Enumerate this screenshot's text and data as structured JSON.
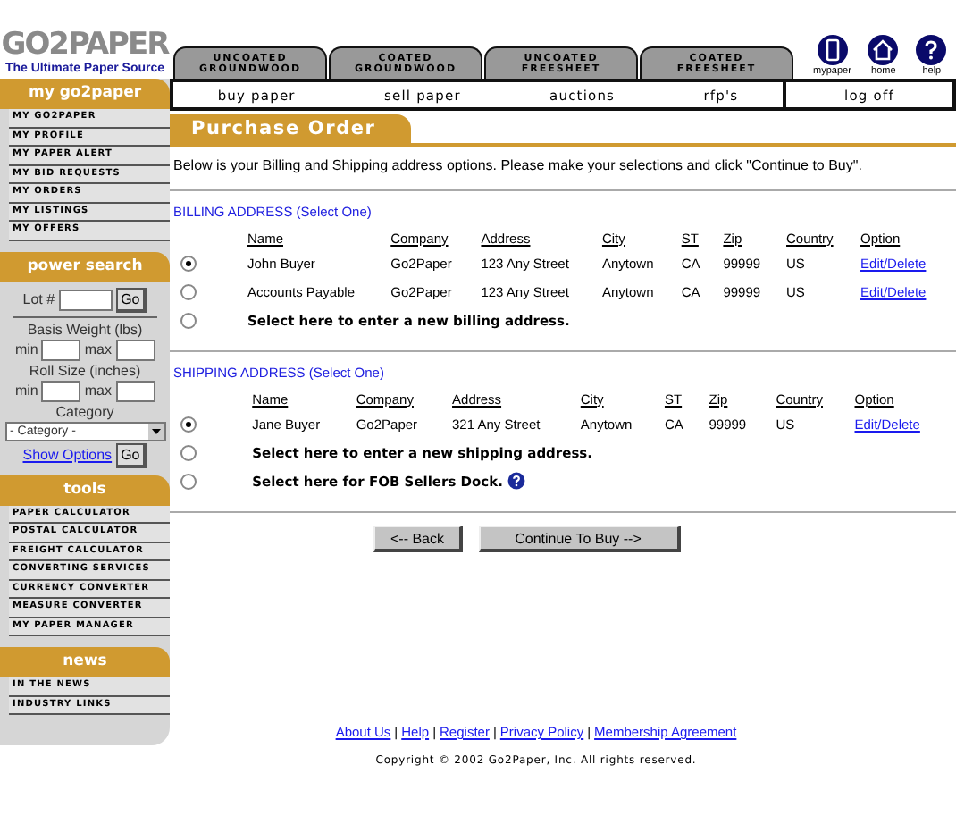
{
  "logo": {
    "text": "GO2PAPER",
    "tagline": "The Ultimate Paper Source"
  },
  "category_tabs": [
    {
      "label": "UNCOATED GROUNDWOOD"
    },
    {
      "label": "COATED GROUNDWOOD"
    },
    {
      "label": "UNCOATED FREESHEET"
    },
    {
      "label": "COATED FREESHEET"
    }
  ],
  "header_icons": [
    {
      "kind": "phone",
      "label": "mypaper"
    },
    {
      "kind": "home",
      "label": "home"
    },
    {
      "kind": "help",
      "label": "help"
    }
  ],
  "nav": {
    "items": [
      "buy paper",
      "sell paper",
      "auctions",
      "rfp's"
    ],
    "logoff": "log off"
  },
  "sidebar": [
    {
      "kind": "links",
      "title": "my go2paper",
      "items": [
        "MY GO2PAPER",
        "MY PROFILE",
        "MY PAPER ALERT",
        "MY BID REQUESTS",
        "MY ORDERS",
        "MY LISTINGS",
        "MY OFFERS"
      ]
    },
    {
      "kind": "search",
      "title": "power search",
      "lot_label": "Lot #",
      "go": "Go",
      "basis_label": "Basis Weight (lbs)",
      "roll_label": "Roll Size (inches)",
      "basis_min": "min",
      "basis_max": "max",
      "roll_min": "min",
      "roll_max": "max",
      "category_label": "Category",
      "category_value": "- Category -",
      "show_options": "Show Options",
      "go2": "Go"
    },
    {
      "kind": "links",
      "title": "tools",
      "items": [
        "PAPER CALCULATOR",
        "POSTAL CALCULATOR",
        "FREIGHT CALCULATOR",
        "CONVERTING SERVICES",
        "CURRENCY CONVERTER",
        "MEASURE CONVERTER",
        "MY PAPER MANAGER"
      ]
    },
    {
      "kind": "links",
      "title": "news",
      "items": [
        "IN THE NEWS",
        "INDUSTRY LINKS"
      ]
    }
  ],
  "page_title": "Purchase Order",
  "intro": "Below is your Billing and Shipping address options.  Please make your selections and click \"Continue to Buy\".",
  "sections": [
    {
      "title": "BILLING ADDRESS (Select One)",
      "columns": [
        "Name",
        "Company",
        "Address",
        "City",
        "ST",
        "Zip",
        "Country",
        "Option"
      ],
      "entries": [
        {
          "kind": "address",
          "selected": true,
          "cells": [
            "John Buyer",
            "Go2Paper",
            "123 Any Street",
            "Anytown",
            "CA",
            "99999",
            "US"
          ],
          "option": "Edit/Delete"
        },
        {
          "kind": "address",
          "selected": false,
          "cells": [
            "Accounts Payable",
            "Go2Paper",
            "123 Any Street",
            "Anytown",
            "CA",
            "99999",
            "US"
          ],
          "option": "Edit/Delete"
        },
        {
          "kind": "choice",
          "selected": false,
          "label": "Select here to enter a new billing address."
        }
      ]
    },
    {
      "title": "SHIPPING ADDRESS (Select One)",
      "columns": [
        "Name",
        "Company",
        "Address",
        "City",
        "ST",
        "Zip",
        "Country",
        "Option"
      ],
      "entries": [
        {
          "kind": "address",
          "selected": true,
          "cells": [
            "Jane Buyer",
            "Go2Paper",
            "321 Any Street",
            "Anytown",
            "CA",
            "99999",
            "US"
          ],
          "option": "Edit/Delete"
        },
        {
          "kind": "choice",
          "selected": false,
          "label": "Select here to enter a new shipping address."
        },
        {
          "kind": "choice_help",
          "selected": false,
          "label": "Select here for FOB Sellers Dock."
        }
      ]
    }
  ],
  "buttons": [
    "<-- Back",
    "Continue To Buy -->"
  ],
  "footer": {
    "separators": [
      "|",
      "|",
      "|",
      "|"
    ],
    "links": [
      "About Us",
      "Help",
      "Register",
      "Privacy Policy",
      "Membership Agreement"
    ],
    "copyright": "Copyright © 2002 Go2Paper, Inc. All rights reserved."
  }
}
